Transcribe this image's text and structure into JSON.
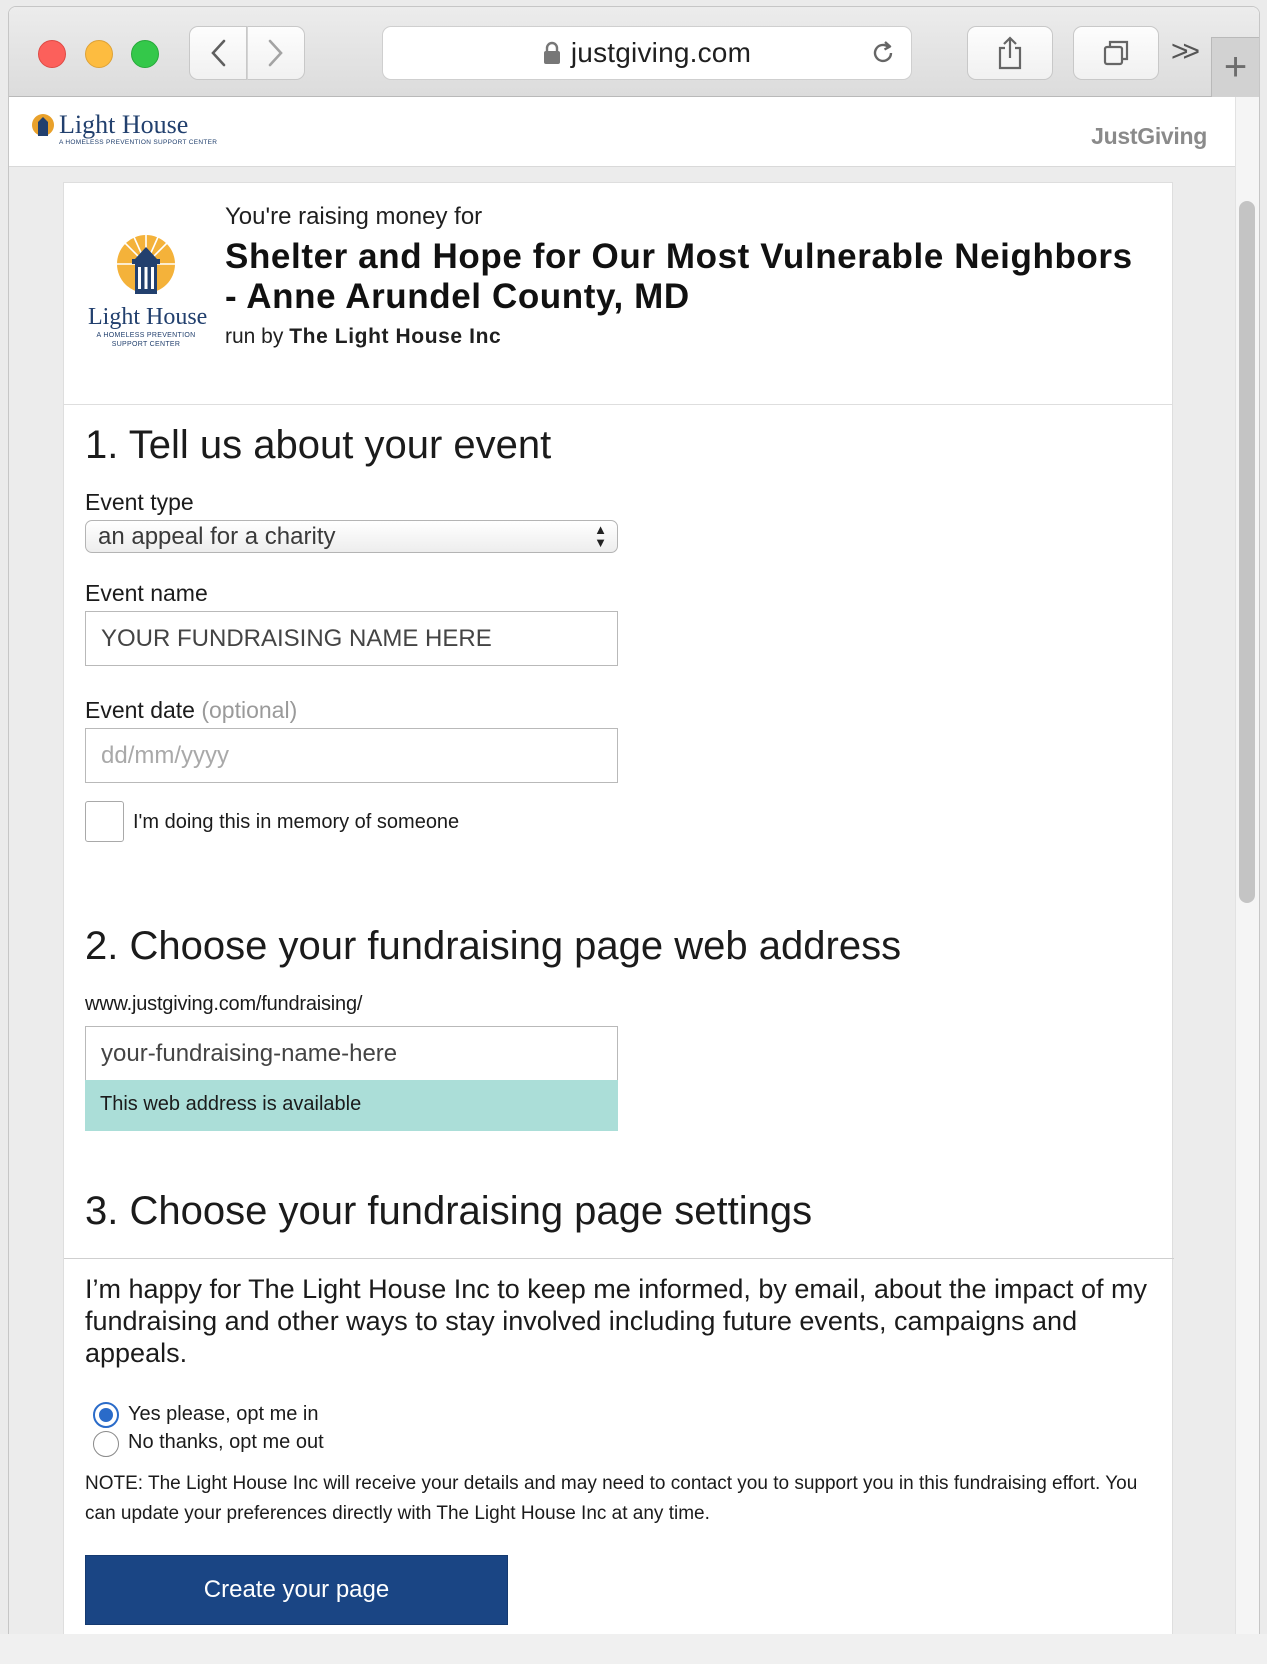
{
  "browser": {
    "url": "justgiving.com",
    "more_label": ">>",
    "new_tab_label": "+"
  },
  "site": {
    "brand_small": "Light House",
    "brand_small_tagline": "A HOMELESS PREVENTION SUPPORT CENTER",
    "platform_logo": "JustGiving"
  },
  "charity": {
    "logo_name": "Light House",
    "logo_tagline": "A HOMELESS PREVENTION SUPPORT CENTER",
    "raising_prefix": "You're raising money for",
    "cause_title": "Shelter and Hope for Our Most Vulnerable Neighbors - Anne Arundel County, MD",
    "run_by_prefix": "run by",
    "run_by_org": "The Light House Inc"
  },
  "section1": {
    "title": "1. Tell us about your event",
    "event_type_label": "Event type",
    "event_type_value": "an appeal for a charity",
    "event_name_label": "Event name",
    "event_name_value": "YOUR FUNDRAISING NAME HERE",
    "event_date_label": "Event date",
    "event_date_optional": "(optional)",
    "event_date_placeholder": "dd/mm/yyyy",
    "memory_checkbox_label": "I'm doing this in memory of someone"
  },
  "section2": {
    "title": "2. Choose your fundraising page web address",
    "url_prefix": "www.justgiving.com/fundraising/",
    "slug_value": "your-fundraising-name-here",
    "availability_message": "This web address is available"
  },
  "section3": {
    "title": "3. Choose your fundraising page settings",
    "consent_text": "I’m happy for The Light House Inc to keep me informed, by email, about the impact of my fundraising and other ways to stay involved including future events, campaigns and appeals.",
    "opt_in_label": "Yes please, opt me in",
    "opt_out_label": "No thanks, opt me out",
    "selected_option": "opt_in",
    "note_text": "NOTE: The Light House Inc will receive your details and may need to contact you to support you in this fundraising effort. You can update your preferences directly with The Light House Inc at any time.",
    "create_button_label": "Create your page"
  },
  "colors": {
    "brand_navy": "#22406e",
    "cta_blue": "#1a4584",
    "available_teal": "#abded8",
    "radio_selected": "#2a6bc9"
  }
}
